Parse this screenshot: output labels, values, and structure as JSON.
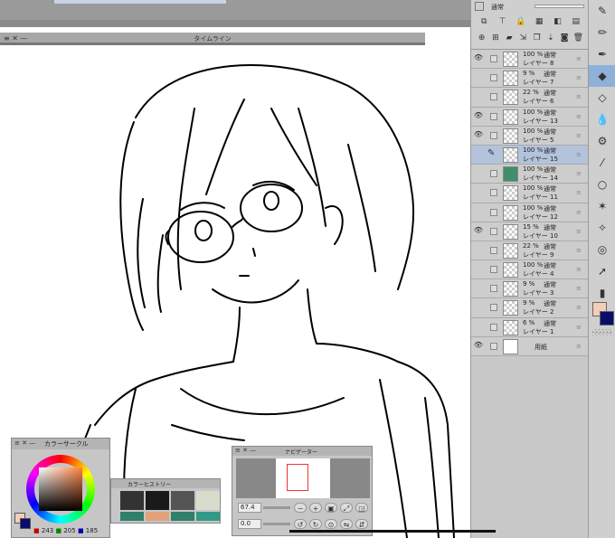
{
  "timeline": {
    "title": "タイムライン"
  },
  "layer_panel": {
    "blend_mode": "通常",
    "layers": [
      {
        "opacity": "100 %",
        "mode": "通常",
        "name": "レイヤー 8",
        "visible": true,
        "thumb": "checker"
      },
      {
        "opacity": "9 %",
        "mode": "通常",
        "name": "レイヤー 7",
        "visible": false,
        "thumb": "checker"
      },
      {
        "opacity": "22 %",
        "mode": "通常",
        "name": "レイヤー 6",
        "visible": false,
        "thumb": "checker"
      },
      {
        "opacity": "100 %",
        "mode": "通常",
        "name": "レイヤー 13",
        "visible": true,
        "thumb": "checker"
      },
      {
        "opacity": "100 %",
        "mode": "通常",
        "name": "レイヤー 5",
        "visible": true,
        "thumb": "checker"
      },
      {
        "opacity": "100 %",
        "mode": "通常",
        "name": "レイヤー 15",
        "visible": false,
        "thumb": "checker",
        "selected": true
      },
      {
        "opacity": "100 %",
        "mode": "通常",
        "name": "レイヤー 14",
        "visible": false,
        "thumb": "green"
      },
      {
        "opacity": "100 %",
        "mode": "通常",
        "name": "レイヤー 11",
        "visible": false,
        "thumb": "checker"
      },
      {
        "opacity": "100 %",
        "mode": "通常",
        "name": "レイヤー 12",
        "visible": false,
        "thumb": "checker"
      },
      {
        "opacity": "15 %",
        "mode": "通常",
        "name": "レイヤー 10",
        "visible": true,
        "thumb": "checker"
      },
      {
        "opacity": "22 %",
        "mode": "通常",
        "name": "レイヤー 9",
        "visible": false,
        "thumb": "checker"
      },
      {
        "opacity": "100 %",
        "mode": "通常",
        "name": "レイヤー 4",
        "visible": false,
        "thumb": "checker"
      },
      {
        "opacity": "9 %",
        "mode": "通常",
        "name": "レイヤー 3",
        "visible": false,
        "thumb": "checker"
      },
      {
        "opacity": "9 %",
        "mode": "通常",
        "name": "レイヤー 2",
        "visible": false,
        "thumb": "checker"
      },
      {
        "opacity": "6 %",
        "mode": "通常",
        "name": "レイヤー 1",
        "visible": false,
        "thumb": "checker"
      },
      {
        "opacity": "",
        "mode": "",
        "name": "用紙",
        "visible": true,
        "thumb": "plain"
      }
    ]
  },
  "color_circle": {
    "title": "カラーサークル",
    "r": "243",
    "g": "205",
    "b": "185",
    "fg": "#f3cdb9",
    "bg": "#0b0b6a"
  },
  "color_history": {
    "title": "カラーヒストリー",
    "colors": [
      "#333333",
      "#1a1a1a",
      "#555555",
      "#d8dccb",
      "#2f7f6a",
      "#e3a27a",
      "#2f7f6a",
      "#2f9b86"
    ]
  },
  "navigator": {
    "title": "ナビゲーター",
    "zoom": "67.4",
    "rotation": "0.0"
  }
}
